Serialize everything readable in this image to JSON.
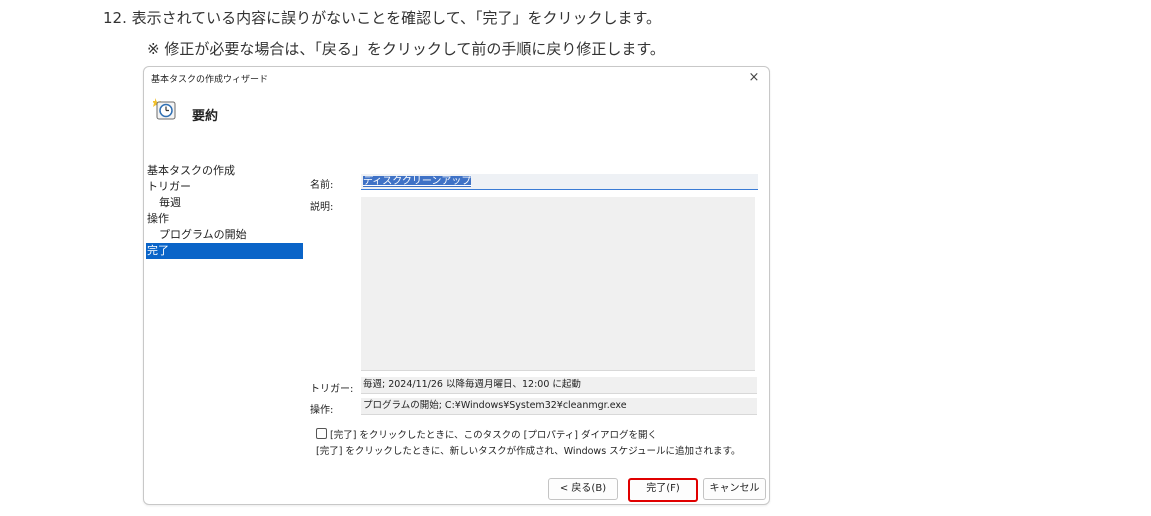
{
  "instructions": {
    "step": "12. 表示されている内容に誤りがないことを確認して、「完了」をクリックします。",
    "note": "※ 修正が必要な場合は、「戻る」をクリックして前の手順に戻り修正します。"
  },
  "dialog": {
    "title": "基本タスクの作成ウィザード",
    "close": "×",
    "header_title": "要約",
    "nav": [
      {
        "label": "基本タスクの作成"
      },
      {
        "label": "トリガー"
      },
      {
        "label": "毎週"
      },
      {
        "label": "操作"
      },
      {
        "label": "プログラムの開始"
      },
      {
        "label": "完了"
      }
    ],
    "name_label": "名前:",
    "name_value": "ディスククリーンアップ",
    "description_label": "説明:",
    "trigger_label": "トリガー:",
    "trigger_value": "毎週; 2024/11/26 以降毎週月曜日、12:00 に起動",
    "action_label": "操作:",
    "action_value": "プログラムの開始; C:¥Windows¥System32¥cleanmgr.exe",
    "checkbox_label": "[完了] をクリックしたときに、このタスクの [プロパティ] ダイアログを開く",
    "finish_note": "[完了] をクリックしたときに、新しいタスクが作成され、Windows スケジュールに追加されます。",
    "buttons": {
      "back": "< 戻る(B)",
      "finish": "完了(F)",
      "cancel": "キャンセル"
    }
  },
  "colors": {
    "selection": "#0a64c8",
    "highlight_border": "#e00000"
  }
}
